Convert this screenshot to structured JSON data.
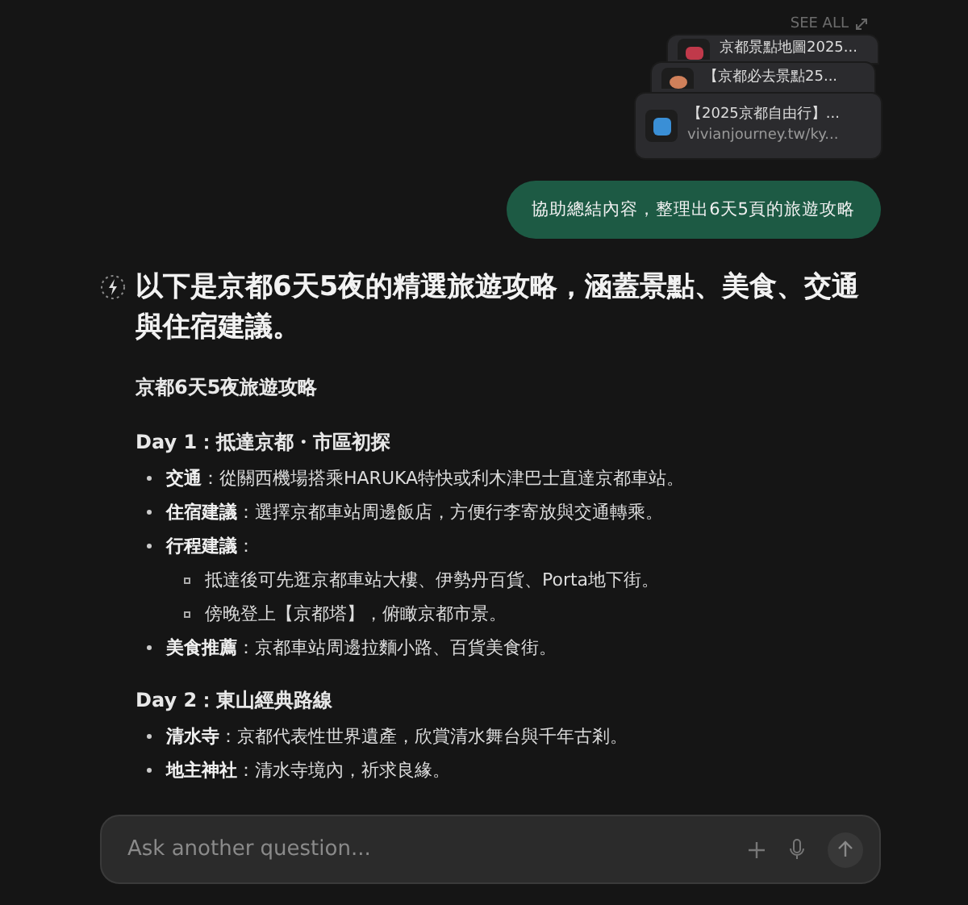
{
  "see_all": "SEE ALL",
  "sources": [
    {
      "title": "京都景點地圖2025..."
    },
    {
      "title": "【京都必去景點25..."
    },
    {
      "title": "【2025京都自由行】...",
      "url": "vivianjourney.tw/ky..."
    }
  ],
  "user_message": "協助總結內容，整理出6天5頁的旅遊攻略",
  "answer": {
    "headline": "以下是京都6天5夜的精選旅遊攻略，涵蓋景點、美食、交通與住宿建議。",
    "title": "京都6天5夜旅遊攻略",
    "days": [
      {
        "heading": "Day 1：抵達京都・市區初探",
        "items": [
          {
            "text": "**交通**：從關西機場搭乘HARUKA特快或利木津巴士直達京都車站。"
          },
          {
            "text": "**住宿建議**：選擇京都車站周邊飯店，方便行李寄放與交通轉乘。"
          },
          {
            "text": "**行程建議**：",
            "children": [
              "抵達後可先逛京都車站大樓、伊勢丹百貨、Porta地下街。",
              "傍晚登上【京都塔】，俯瞰京都市景。"
            ]
          },
          {
            "text": "**美食推薦**：京都車站周邊拉麵小路、百貨美食街。"
          }
        ]
      },
      {
        "heading": "Day 2：東山經典路線",
        "items": [
          {
            "text": "**清水寺**：京都代表性世界遺產，欣賞清水舞台與千年古剎。"
          },
          {
            "text": "**地主神社**：清水寺境內，祈求良緣。"
          }
        ]
      }
    ]
  },
  "composer": {
    "placeholder": "Ask another question..."
  }
}
